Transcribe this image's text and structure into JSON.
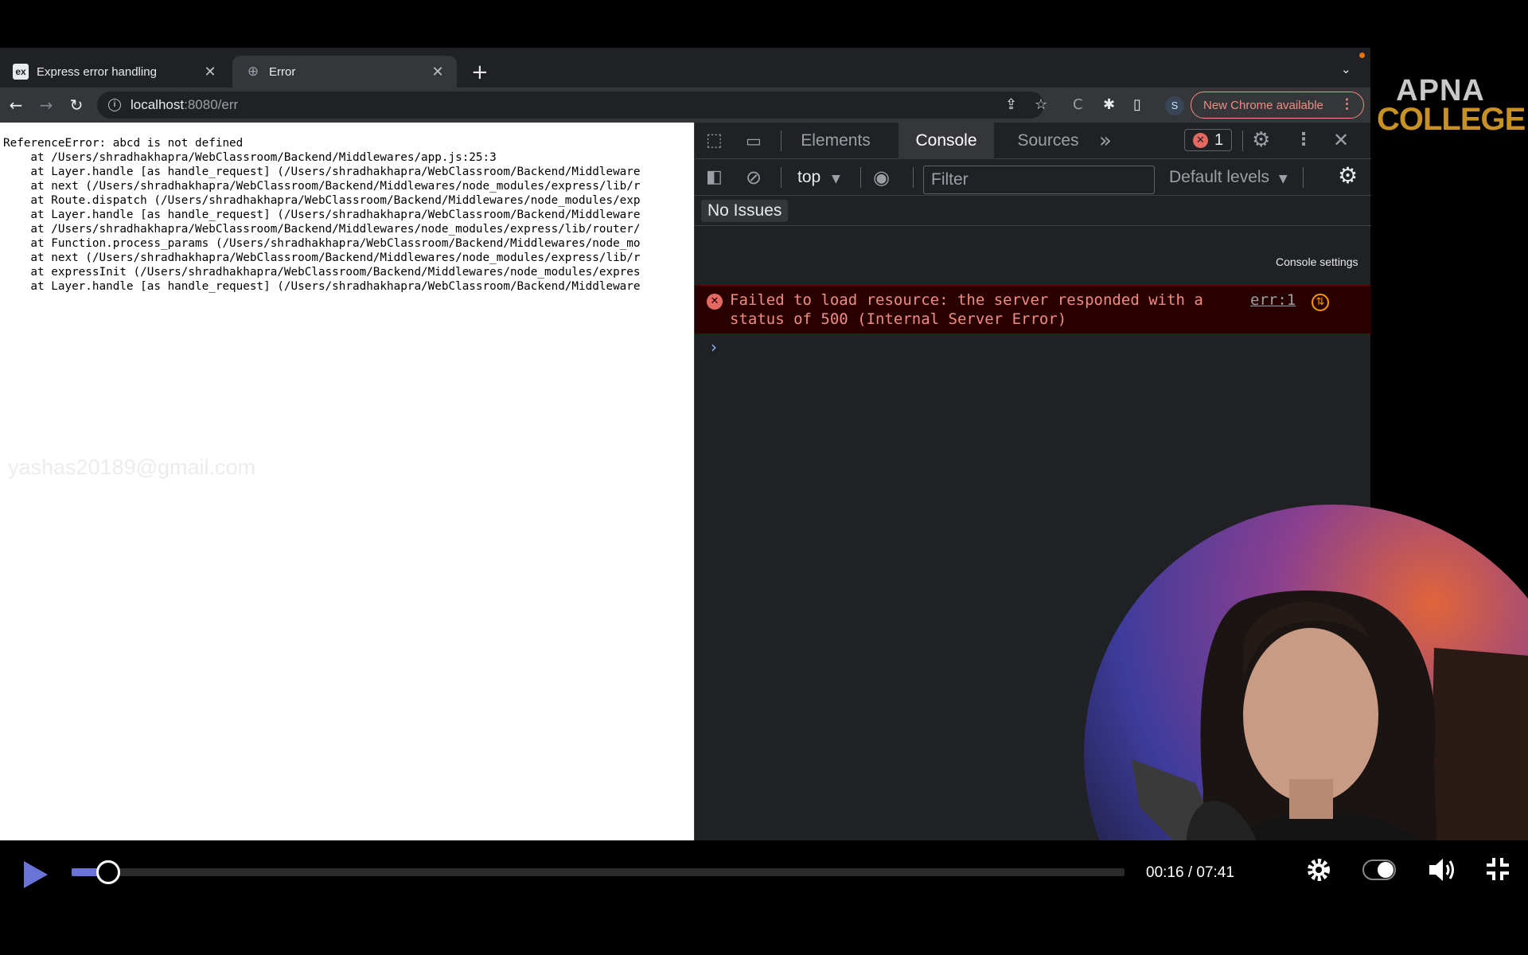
{
  "browser": {
    "tabs": [
      {
        "favicon": "ex",
        "title": "Express error handling",
        "close": "✕"
      },
      {
        "favicon": "globe-icon",
        "title": "Error",
        "close": "✕"
      }
    ],
    "new_tab": "+",
    "tab_search": "⌄",
    "address": {
      "host": "localhost",
      "rest": ":8080/err"
    },
    "profile_initial": "S",
    "update_button": "New Chrome available",
    "update_menu": "⋮"
  },
  "page": {
    "stack_trace": [
      "ReferenceError: abcd is not defined",
      "    at /Users/shradhakhapra/WebClassroom/Backend/Middlewares/app.js:25:3",
      "    at Layer.handle [as handle_request] (/Users/shradhakhapra/WebClassroom/Backend/Middleware",
      "    at next (/Users/shradhakhapra/WebClassroom/Backend/Middlewares/node_modules/express/lib/r",
      "    at Route.dispatch (/Users/shradhakhapra/WebClassroom/Backend/Middlewares/node_modules/exp",
      "    at Layer.handle [as handle_request] (/Users/shradhakhapra/WebClassroom/Backend/Middleware",
      "    at /Users/shradhakhapra/WebClassroom/Backend/Middlewares/node_modules/express/lib/router/",
      "    at Function.process_params (/Users/shradhakhapra/WebClassroom/Backend/Middlewares/node_mo",
      "    at next (/Users/shradhakhapra/WebClassroom/Backend/Middlewares/node_modules/express/lib/r",
      "    at expressInit (/Users/shradhakhapra/WebClassroom/Backend/Middlewares/node_modules/expres",
      "    at Layer.handle [as handle_request] (/Users/shradhakhapra/WebClassroom/Backend/Middleware"
    ],
    "watermark": "yashas20189@gmail.com"
  },
  "devtools": {
    "tabs": [
      {
        "label": "Elements",
        "active": false
      },
      {
        "label": "Console",
        "active": true
      },
      {
        "label": "Sources",
        "active": false
      }
    ],
    "more_tabs": "»",
    "error_count": "1",
    "context": "top",
    "filter_placeholder": "Filter",
    "levels": "Default levels",
    "tooltip": "Console settings",
    "issues": "No Issues",
    "console_error": {
      "message": "Failed to load resource: the server responded with a status of 500 (Internal Server Error)",
      "source": "err:1"
    },
    "prompt": "›"
  },
  "branding": {
    "line1": "APNA",
    "line2": "COLLEGE"
  },
  "player": {
    "current_time": "00:16",
    "duration": "07:41",
    "time_display": "00:16 / 07:41",
    "progress_fraction": 0.035
  },
  "colors": {
    "accent": "#6a74d6",
    "error_text": "#f28b82",
    "error_bg": "#290000",
    "logo_gold": "#c79126"
  }
}
